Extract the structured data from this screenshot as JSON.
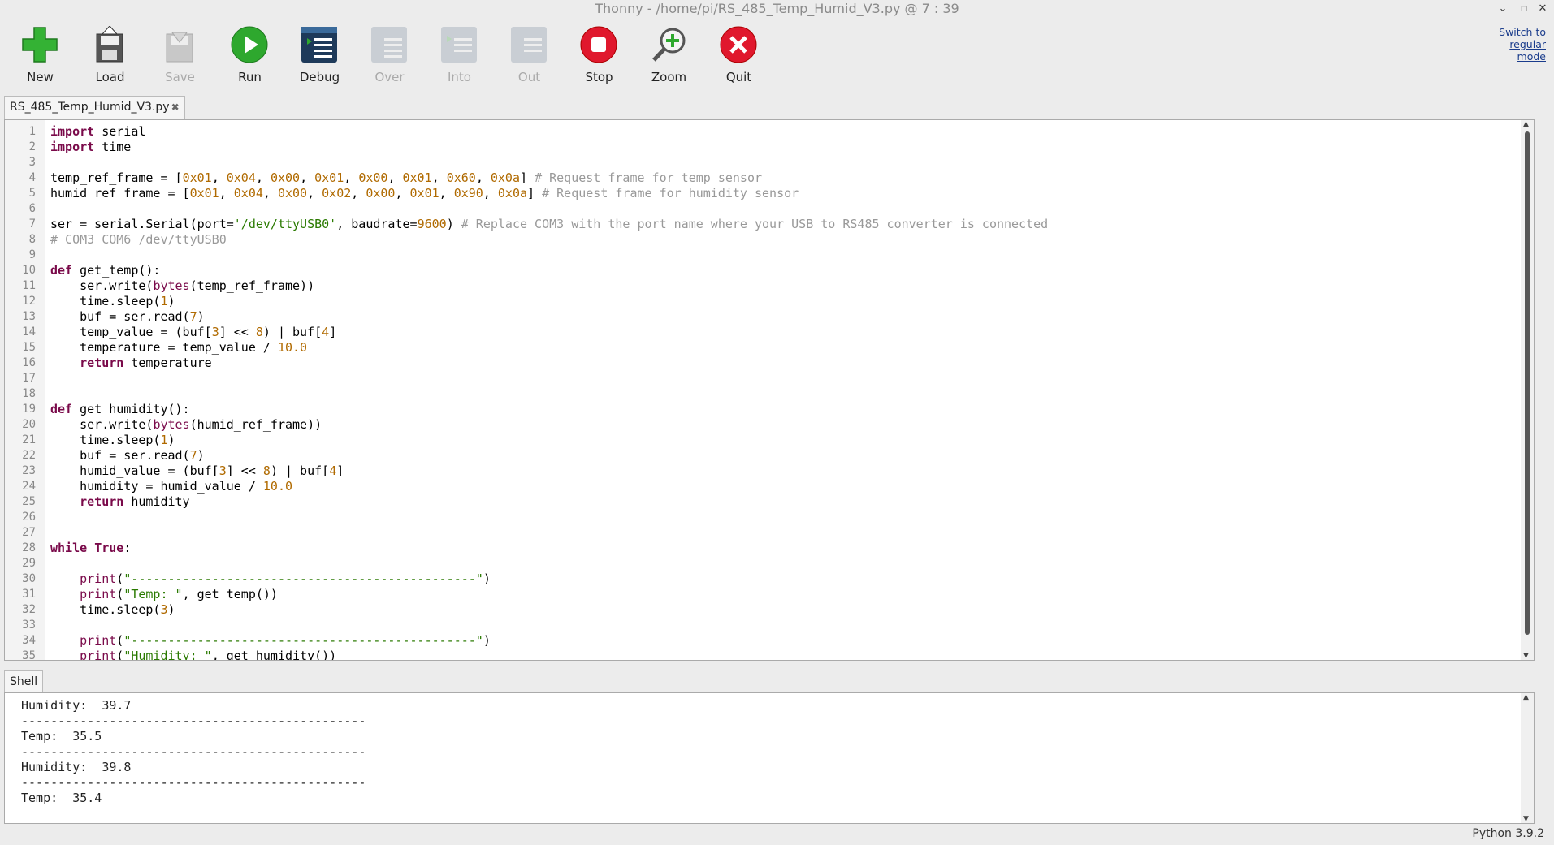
{
  "window": {
    "title": "Thonny  -  /home/pi/RS_485_Temp_Humid_V3.py  @  7 : 39"
  },
  "toolbar": {
    "buttons": [
      {
        "label": "New",
        "icon": "plus-icon",
        "enabled": true
      },
      {
        "label": "Load",
        "icon": "load-icon",
        "enabled": true
      },
      {
        "label": "Save",
        "icon": "save-icon",
        "enabled": false
      },
      {
        "label": "Run",
        "icon": "run-icon",
        "enabled": true
      },
      {
        "label": "Debug",
        "icon": "debug-icon",
        "enabled": true
      },
      {
        "label": "Over",
        "icon": "step-over-icon",
        "enabled": false
      },
      {
        "label": "Into",
        "icon": "step-into-icon",
        "enabled": false
      },
      {
        "label": "Out",
        "icon": "step-out-icon",
        "enabled": false
      },
      {
        "label": "Stop",
        "icon": "stop-icon",
        "enabled": true
      },
      {
        "label": "Zoom",
        "icon": "zoom-icon",
        "enabled": true
      },
      {
        "label": "Quit",
        "icon": "quit-icon",
        "enabled": true
      }
    ],
    "switch_mode_label": "Switch to regular mode"
  },
  "editor": {
    "tab_label": "RS_485_Temp_Humid_V3.py",
    "lines": [
      "import serial",
      "import time",
      "",
      "temp_ref_frame = [0x01, 0x04, 0x00, 0x01, 0x00, 0x01, 0x60, 0x0a] # Request frame for temp sensor",
      "humid_ref_frame = [0x01, 0x04, 0x00, 0x02, 0x00, 0x01, 0x90, 0x0a] # Request frame for humidity sensor",
      "",
      "ser = serial.Serial(port='/dev/ttyUSB0', baudrate=9600) # Replace COM3 with the port name where your USB to RS485 converter is connected",
      "# COM3 COM6 /dev/ttyUSB0",
      "",
      "def get_temp():",
      "    ser.write(bytes(temp_ref_frame))",
      "    time.sleep(1)",
      "    buf = ser.read(7)",
      "    temp_value = (buf[3] << 8) | buf[4]",
      "    temperature = temp_value / 10.0",
      "    return temperature",
      "",
      "",
      "def get_humidity():",
      "    ser.write(bytes(humid_ref_frame))",
      "    time.sleep(1)",
      "    buf = ser.read(7)",
      "    humid_value = (buf[3] << 8) | buf[4]",
      "    humidity = humid_value / 10.0",
      "    return humidity",
      "",
      "",
      "while True:",
      "",
      "    print(\"-----------------------------------------------\")",
      "    print(\"Temp: \", get_temp())",
      "    time.sleep(3)",
      "",
      "    print(\"-----------------------------------------------\")",
      "    print(\"Humidity: \", get_humidity())"
    ]
  },
  "shell": {
    "tab_label": "Shell",
    "output": [
      "Humidity:  39.7",
      "-----------------------------------------------",
      "Temp:  35.5",
      "-----------------------------------------------",
      "Humidity:  39.8",
      "-----------------------------------------------",
      "Temp:  35.4"
    ]
  },
  "status": {
    "python_version": "Python 3.9.2"
  },
  "colors": {
    "run": "#2ea82e",
    "stop": "#e0182d",
    "new": "#2ea82e",
    "debug": "#1e3a5a"
  }
}
